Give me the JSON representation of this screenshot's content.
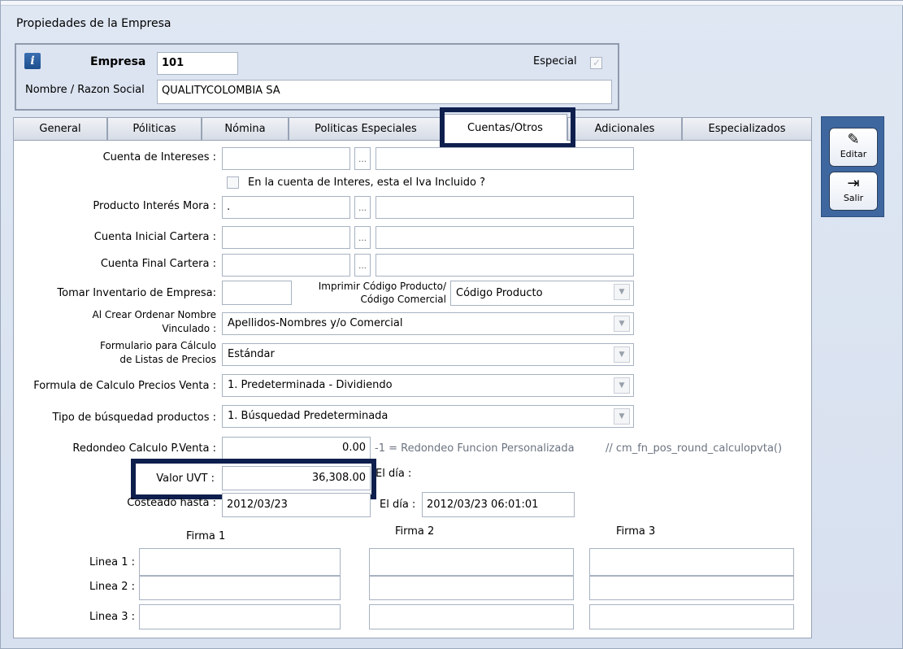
{
  "window": {
    "title": "Propiedades de la Empresa"
  },
  "header": {
    "empresa_label": "Empresa",
    "empresa_value": "101",
    "razon_label": "Nombre / Razon Social",
    "razon_value": "QUALITYCOLOMBIA SA",
    "especial_label": "Especial",
    "especial_checked": true
  },
  "tabs": [
    {
      "label": "General"
    },
    {
      "label": "Póliticas"
    },
    {
      "label": "Nómina"
    },
    {
      "label": "Politicas Especiales"
    },
    {
      "label": "Cuentas/Otros",
      "active": true
    },
    {
      "label": "Adicionales"
    },
    {
      "label": "Especializados"
    }
  ],
  "form": {
    "cuenta_intereses_label": "Cuenta de Intereses :",
    "iva_check_label": "En la cuenta de Interes, esta el Iva Incluido ?",
    "producto_interes_label": "Producto Interés Mora :",
    "producto_interes_value": ".",
    "cuenta_inicial_label": "Cuenta Inicial Cartera :",
    "cuenta_final_label": "Cuenta Final Cartera :",
    "tomar_inventario_label": "Tomar Inventario de Empresa:",
    "imprimir_codigo_label_1": "Imprimir Código Producto/",
    "imprimir_codigo_label_2": "Código Comercial",
    "imprimir_codigo_value": "Código Producto",
    "ordenar_label_1": "Al Crear Ordenar Nombre",
    "ordenar_label_2": "Vinculado :",
    "ordenar_value": "Apellidos-Nombres y/o Comercial",
    "formulario_label_1": "Formulario para Cálculo",
    "formulario_label_2": "de Listas de Precios",
    "formulario_value": "Estándar",
    "formula_label": "Formula de Calculo Precios Venta :",
    "formula_value": "1. Predeterminada - Dividiendo",
    "tipo_busqueda_label": "Tipo de búsquedad productos :",
    "tipo_busqueda_value": "1. Búsquedad Predeterminada",
    "redondeo_label": "Redondeo Calculo P.Venta :",
    "redondeo_value": "0.00",
    "redondeo_hint": "-1 = Redondeo Funcion Personalizada",
    "redondeo_func": "// cm_fn_pos_round_calculopvta()",
    "uvt_label": "Valor UVT :",
    "uvt_value": "36,308.00",
    "uvt_dia_label": "El día :",
    "costeado_label": "Costeado hasta :",
    "costeado_value": "2012/03/23",
    "costeado_dia_label": "El día :",
    "costeado_dia_value": "2012/03/23 06:01:01",
    "firma1": "Firma 1",
    "firma2": "Firma 2",
    "firma3": "Firma 3",
    "linea1": "Linea 1 :",
    "linea2": "Linea 2 :",
    "linea3": "Linea 3 :"
  },
  "sidebar": {
    "editar_label": "Editar",
    "salir_label": "Salir"
  },
  "colors": {
    "highlight": "#0e1f4d",
    "sidebar": "#3e67a0"
  }
}
